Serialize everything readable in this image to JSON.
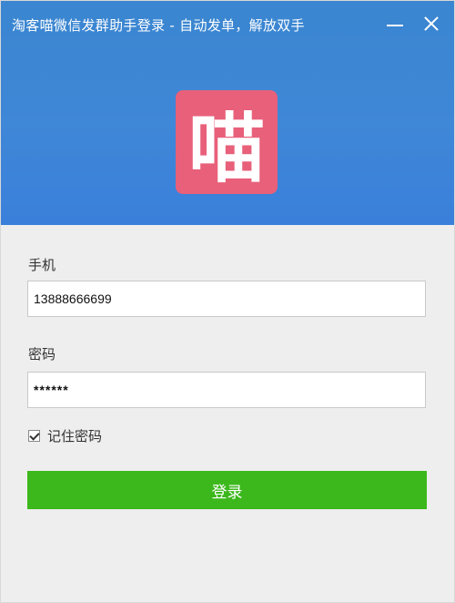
{
  "window": {
    "title": "淘客喵微信发群助手登录 - 自动发单，解放双手",
    "minimize_icon": "minimize-icon",
    "close_icon": "close-icon"
  },
  "logo": {
    "text": "喵",
    "background_color": "#e8607a"
  },
  "form": {
    "phone_label": "手机",
    "phone_value": "13888666699",
    "password_label": "密码",
    "password_value": "******",
    "remember_label": "记住密码",
    "remember_checked": true,
    "login_label": "登录"
  },
  "colors": {
    "header": "#3f87d7",
    "login_button": "#3cb81c"
  }
}
